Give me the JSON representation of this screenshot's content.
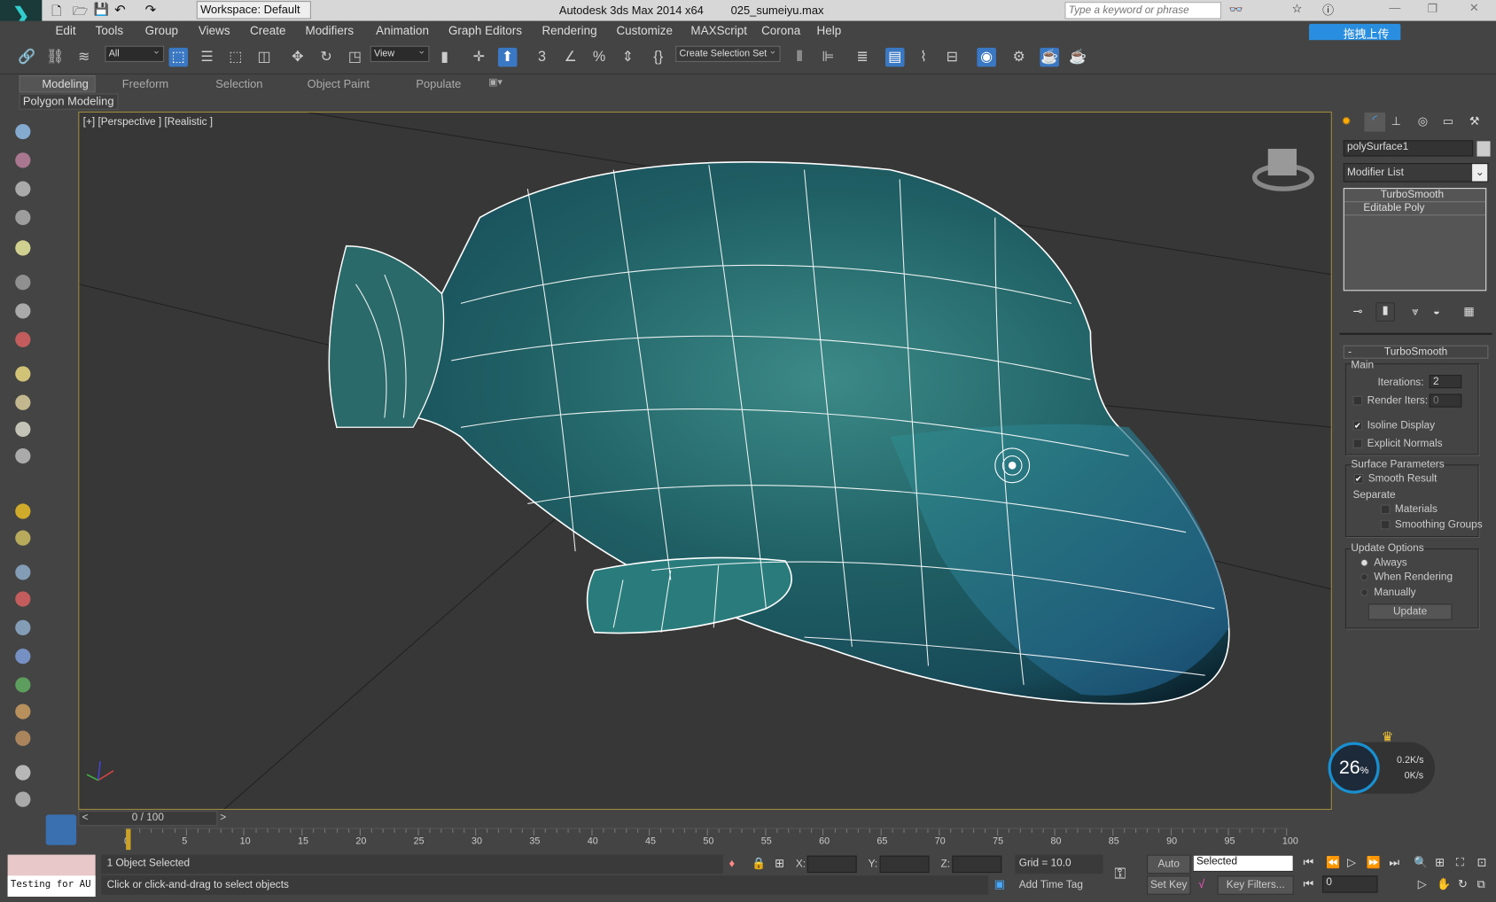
{
  "titlebar": {
    "workspace": "Workspace: Default",
    "app_title": "Autodesk 3ds Max  2014 x64",
    "file_name": "025_sumeiyu.max",
    "search_placeholder": "Type a keyword or phrase",
    "upload_label": "拖拽上传"
  },
  "menu": [
    "Edit",
    "Tools",
    "Group",
    "Views",
    "Create",
    "Modifiers",
    "Animation",
    "Graph Editors",
    "Rendering",
    "Customize",
    "MAXScript",
    "Corona",
    "Help"
  ],
  "toolbar": {
    "selection_filter": "All",
    "ref_coord": "View",
    "named_selection": "Create Selection Set",
    "snap_label": "3",
    "percent_label": "%"
  },
  "ribbon": {
    "tabs": [
      "Modeling",
      "Freeform",
      "Selection",
      "Object Paint",
      "Populate"
    ],
    "active_tab": "Modeling",
    "panel_label": "Polygon Modeling"
  },
  "viewport": {
    "label": "[+] [Perspective ] [Realistic ]"
  },
  "command_panel": {
    "object_name": "polySurface1",
    "modifier_list": "Modifier List",
    "stack": [
      "TurboSmooth",
      "Editable Poly"
    ],
    "rollout_title": "TurboSmooth",
    "rollout_toggle": "-",
    "main_group": "Main",
    "iterations_label": "Iterations:",
    "iterations_value": "2",
    "render_iters_label": "Render Iters:",
    "render_iters_value": "0",
    "isoline_label": "Isoline Display",
    "isoline_checked": true,
    "explicit_normals_label": "Explicit Normals",
    "explicit_normals_checked": false,
    "surface_group": "Surface Parameters",
    "smooth_result_label": "Smooth Result",
    "smooth_result_checked": true,
    "separate_label": "Separate",
    "materials_label": "Materials",
    "smoothing_groups_label": "Smoothing Groups",
    "update_group": "Update Options",
    "update_options": [
      "Always",
      "When Rendering",
      "Manually"
    ],
    "update_selected": "Always",
    "update_button": "Update"
  },
  "netmon": {
    "percent": "26",
    "percent_sign": "%",
    "up": "0.2K/s",
    "down": "0K/s"
  },
  "timeline": {
    "frame": "0 / 100",
    "ticks": [
      "0",
      "5",
      "10",
      "15",
      "20",
      "25",
      "30",
      "35",
      "40",
      "45",
      "50",
      "55",
      "60",
      "65",
      "70",
      "75",
      "80",
      "85",
      "90",
      "95",
      "100"
    ]
  },
  "status": {
    "maxscript": "Testing for AU",
    "selected": "1 Object Selected",
    "prompt": "Click or click-and-drag to select objects",
    "x_label": "X:",
    "y_label": "Y:",
    "z_label": "Z:",
    "grid": "Grid = 10.0",
    "add_time_tag": "Add Time Tag",
    "auto_key": "Auto Key",
    "set_key": "Set Key",
    "key_mode": "Selected",
    "key_filters": "Key Filters...",
    "current_frame": "0"
  }
}
